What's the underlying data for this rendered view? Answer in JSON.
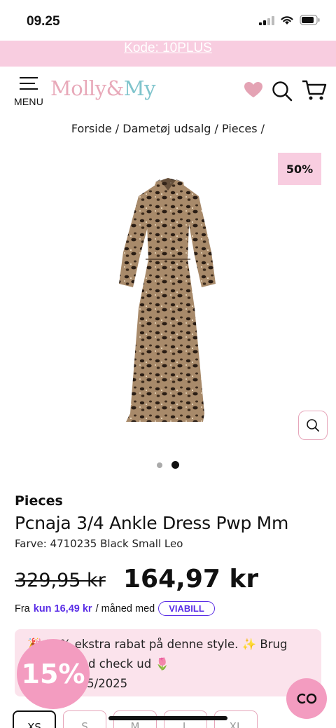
{
  "status_bar": {
    "time": "09.25"
  },
  "promo_bar": {
    "text": "Kode: 10PLUS"
  },
  "header": {
    "menu_label": "MENU",
    "logo_part1": "Molly",
    "logo_amp": "&",
    "logo_part2": "My",
    "icons": [
      "heart-icon",
      "search-icon",
      "cart-icon"
    ]
  },
  "breadcrumb": {
    "text": "Forside / Dametøj udsalg / Pieces /"
  },
  "product": {
    "discount_badge": "50%",
    "gallery": {
      "count": 2,
      "active_index": 1
    },
    "brand": "Pieces",
    "title": "Pcnaja 3/4 Ankle Dress Pwp Mm",
    "color": "Farve: 4710235 Black Small Leo",
    "price_old": "329,95 kr",
    "price_new": "164,97 kr"
  },
  "finance": {
    "prefix": "Fra",
    "amount": "kun 16,49 kr",
    "suffix": "/ måned med",
    "provider": "VIABILL"
  },
  "promo_box": {
    "line1": "🎉 10% ekstra rabat på denne style. ✨ Brug",
    "line2": "10PLUS ved check ud 🌷",
    "line3": "t.o.m 20/05/2025"
  },
  "floating": {
    "percent": "15%"
  },
  "sizes": [
    "XS",
    "S",
    "M",
    "L",
    "XL"
  ],
  "selected_size": "XS",
  "colors": {
    "pink": "#f8cde0",
    "accent_pink": "#f39cc0",
    "viabill": "#5a2de6"
  }
}
